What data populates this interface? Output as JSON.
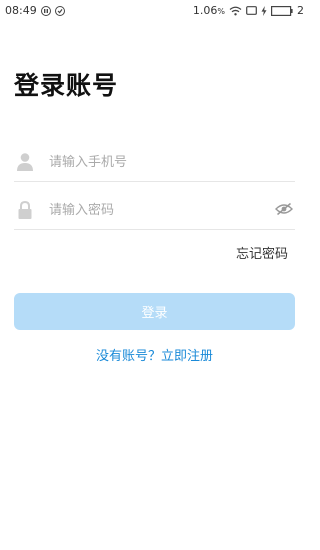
{
  "status_bar": {
    "time": "08:49",
    "speed": "1.06",
    "speed_unit": "%",
    "notification_count": "2",
    "icons": [
      "pause-circle-icon",
      "check-circle-icon",
      "wifi-icon",
      "screen-icon",
      "bolt-icon",
      "battery-icon"
    ]
  },
  "page": {
    "title": "登录账号"
  },
  "form": {
    "phone": {
      "icon": "user-icon",
      "placeholder": "请输入手机号",
      "value": ""
    },
    "password": {
      "icon": "lock-icon",
      "placeholder": "请输入密码",
      "value": "",
      "toggle_icon": "eye-off-icon"
    },
    "forgot_label": "忘记密码",
    "login_label": "登录",
    "register_label": "没有账号？立即注册"
  },
  "colors": {
    "button_bg": "#b5dcf8",
    "link": "#1a8ad8",
    "placeholder": "#aaaaaa"
  }
}
